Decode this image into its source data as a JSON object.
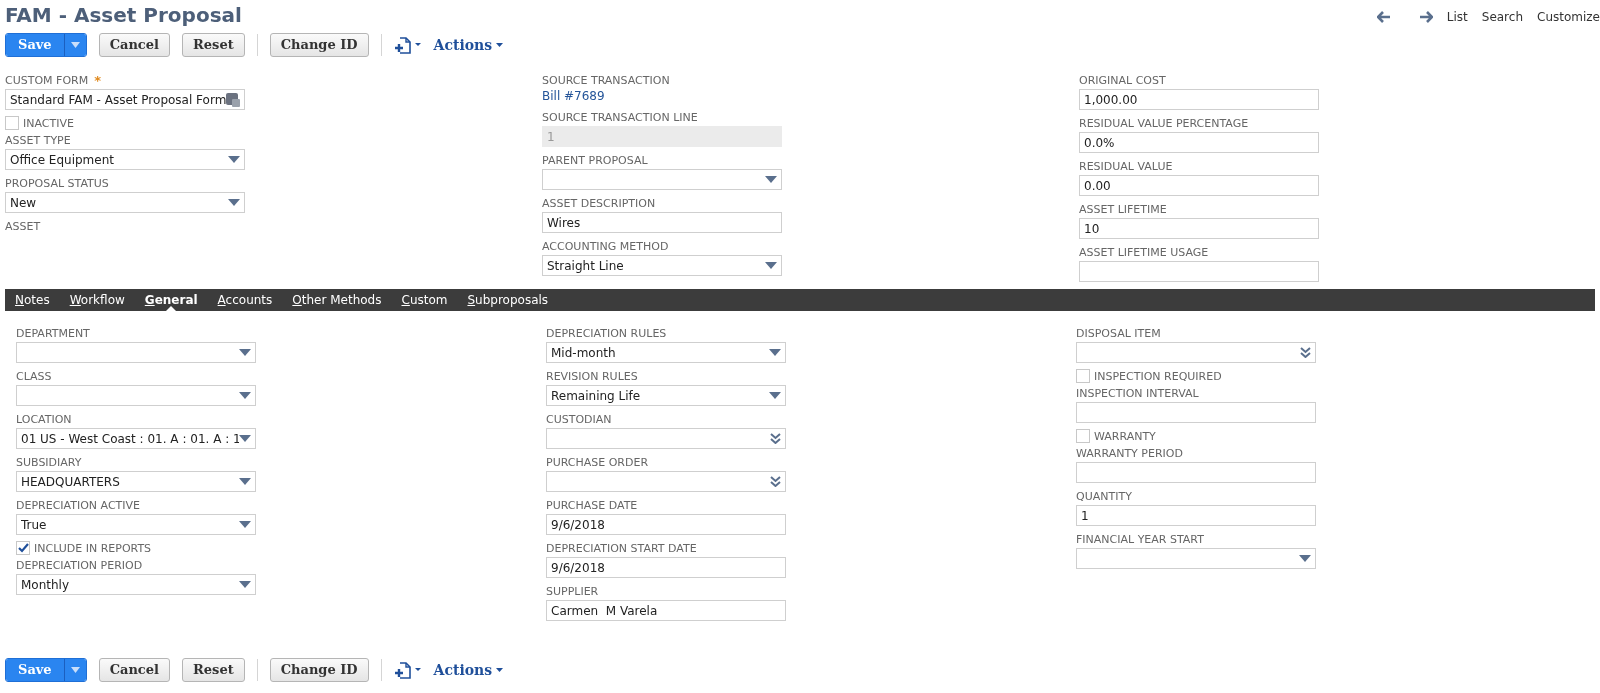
{
  "title": "FAM - Asset Proposal",
  "nav": [
    "List",
    "Search",
    "Customize"
  ],
  "toolbar_top": [
    {
      "kind": "primary",
      "label": "Save"
    },
    {
      "kind": "button",
      "label": "Cancel"
    },
    {
      "kind": "button",
      "label": "Reset"
    },
    {
      "kind": "separator"
    },
    {
      "kind": "button",
      "label": "Change ID"
    },
    {
      "kind": "separator"
    },
    {
      "kind": "new-menu"
    },
    {
      "kind": "menu",
      "label": "Actions"
    }
  ],
  "main_columns": [
    [
      {
        "kind": "popup",
        "label": "CUSTOM FORM",
        "required_mark": "*",
        "value": "Standard FAM - Asset Proposal Form"
      },
      {
        "kind": "checkbox",
        "label": "INACTIVE",
        "checked": false
      },
      {
        "kind": "select",
        "label": "ASSET TYPE",
        "value": "Office Equipment"
      },
      {
        "kind": "select",
        "label": "PROPOSAL STATUS",
        "value": "New"
      },
      {
        "kind": "label",
        "label": "ASSET"
      }
    ],
    [
      {
        "kind": "link",
        "label": "SOURCE TRANSACTION",
        "value": "Bill #7689"
      },
      {
        "kind": "readonly",
        "label": "SOURCE TRANSACTION LINE",
        "value": "1"
      },
      {
        "kind": "select",
        "label": "PARENT PROPOSAL"
      },
      {
        "kind": "text",
        "label": "ASSET DESCRIPTION",
        "value": "Wires"
      },
      {
        "kind": "select",
        "label": "ACCOUNTING METHOD",
        "value": "Straight Line"
      }
    ],
    [
      {
        "kind": "text",
        "label": "ORIGINAL COST",
        "value": "1,000.00"
      },
      {
        "kind": "text",
        "label": "RESIDUAL VALUE PERCENTAGE",
        "value": "0.0%"
      },
      {
        "kind": "text",
        "label": "RESIDUAL VALUE",
        "value": "0.00"
      },
      {
        "kind": "text",
        "label": "ASSET LIFETIME",
        "value": "10"
      },
      {
        "kind": "text",
        "label": "ASSET LIFETIME USAGE"
      }
    ]
  ],
  "tabs": [
    {
      "label": "Notes",
      "selected": false
    },
    {
      "label": "Workflow",
      "selected": false
    },
    {
      "label": "General",
      "selected": true
    },
    {
      "label": "Accounts",
      "selected": false
    },
    {
      "label": "Other Methods",
      "selected": false
    },
    {
      "label": "Custom",
      "selected": false
    },
    {
      "label": "Subproposals",
      "selected": false
    }
  ],
  "tab_columns": [
    [
      {
        "kind": "select",
        "label": "DEPARTMENT"
      },
      {
        "kind": "select",
        "label": "CLASS"
      },
      {
        "kind": "select",
        "label": "LOCATION",
        "value": "01 US - West Coast : 01. A : 01. A : 1"
      },
      {
        "kind": "select",
        "label": "SUBSIDIARY",
        "value": "HEADQUARTERS"
      },
      {
        "kind": "select",
        "label": "DEPRECIATION ACTIVE",
        "value": "True"
      },
      {
        "kind": "checkbox",
        "label": "INCLUDE IN REPORTS",
        "checked": true
      },
      {
        "kind": "select",
        "label": "DEPRECIATION PERIOD",
        "value": "Monthly"
      }
    ],
    [
      {
        "kind": "select",
        "label": "DEPRECIATION RULES",
        "value": "Mid-month"
      },
      {
        "kind": "select",
        "label": "REVISION RULES",
        "value": "Remaining Life"
      },
      {
        "kind": "lookup",
        "label": "CUSTODIAN"
      },
      {
        "kind": "lookup",
        "label": "PURCHASE ORDER"
      },
      {
        "kind": "text",
        "label": "PURCHASE DATE",
        "value": "9/6/2018"
      },
      {
        "kind": "text",
        "label": "DEPRECIATION START DATE",
        "value": "9/6/2018"
      },
      {
        "kind": "text",
        "label": "SUPPLIER",
        "value": "Carmen  M Varela"
      }
    ],
    [
      {
        "kind": "lookup",
        "label": "DISPOSAL ITEM"
      },
      {
        "kind": "checkbox",
        "label": "INSPECTION REQUIRED",
        "checked": false
      },
      {
        "kind": "text",
        "label": "INSPECTION INTERVAL"
      },
      {
        "kind": "checkbox",
        "label": "WARRANTY",
        "checked": false
      },
      {
        "kind": "text",
        "label": "WARRANTY PERIOD"
      },
      {
        "kind": "text",
        "label": "QUANTITY",
        "value": "1"
      },
      {
        "kind": "select",
        "label": "FINANCIAL YEAR START"
      }
    ]
  ],
  "toolbar_bottom": [
    {
      "kind": "primary",
      "label": "Save"
    },
    {
      "kind": "button",
      "label": "Cancel"
    },
    {
      "kind": "button",
      "label": "Reset"
    },
    {
      "kind": "separator"
    },
    {
      "kind": "button",
      "label": "Change ID"
    },
    {
      "kind": "separator"
    },
    {
      "kind": "new-menu"
    },
    {
      "kind": "menu",
      "label": "Actions"
    }
  ]
}
